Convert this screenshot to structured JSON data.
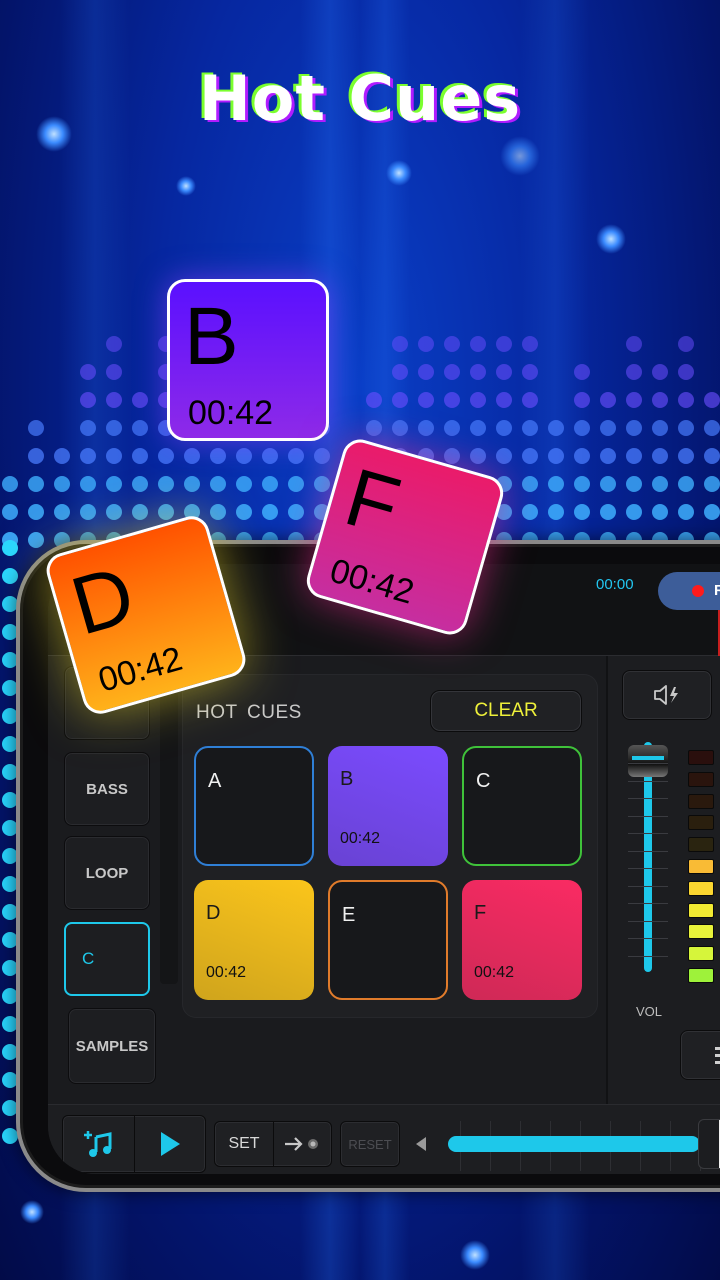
{
  "headline": "Hot Cues",
  "floating_cards": [
    {
      "letter": "B",
      "time": "00:42",
      "color": "#6a1cff"
    },
    {
      "letter": "F",
      "time": "00:42",
      "color": "#e21d76"
    },
    {
      "letter": "D",
      "time": "00:42",
      "color": "#ff6a00"
    }
  ],
  "deck": {
    "time_readout": "00:00",
    "record_button_label": "R",
    "side_buttons": [
      {
        "label": "",
        "state": "normal"
      },
      {
        "label": "BASS",
        "state": "normal"
      },
      {
        "label": "LOOP",
        "state": "normal"
      },
      {
        "label": "C",
        "state": "active"
      },
      {
        "label": "SAMPLES",
        "state": "normal"
      }
    ],
    "hot_cues": {
      "title": "HOT CUES",
      "clear_label": "CLEAR",
      "pads": [
        {
          "letter": "A",
          "time": "",
          "set": false,
          "color": "#2f7fd6"
        },
        {
          "letter": "B",
          "time": "00:42",
          "set": true,
          "color": "#7b4bff"
        },
        {
          "letter": "C",
          "time": "",
          "set": false,
          "color": "#3fc23a"
        },
        {
          "letter": "D",
          "time": "00:42",
          "set": true,
          "color": "#fbc51b"
        },
        {
          "letter": "E",
          "time": "",
          "set": false,
          "color": "#e07b2b"
        },
        {
          "letter": "F",
          "time": "00:42",
          "set": true,
          "color": "#fa2b63"
        }
      ]
    },
    "volume": {
      "label": "VOL",
      "level": 0.97,
      "icon": "speaker-bolt-icon"
    },
    "level_meter": {
      "lit_segments": 6,
      "total_segments": 11
    },
    "bottom_bar": {
      "add_music_icon": "music-plus-icon",
      "play_icon": "play-icon",
      "set_label": "SET",
      "jump_icon": "arrow-right-dot-icon",
      "reset_label": "RESET",
      "pitch_value": 1.0
    }
  },
  "colors": {
    "accent": "#1ec8ea",
    "clear_text": "#eef03a",
    "record_dot": "#ff1b1b"
  }
}
